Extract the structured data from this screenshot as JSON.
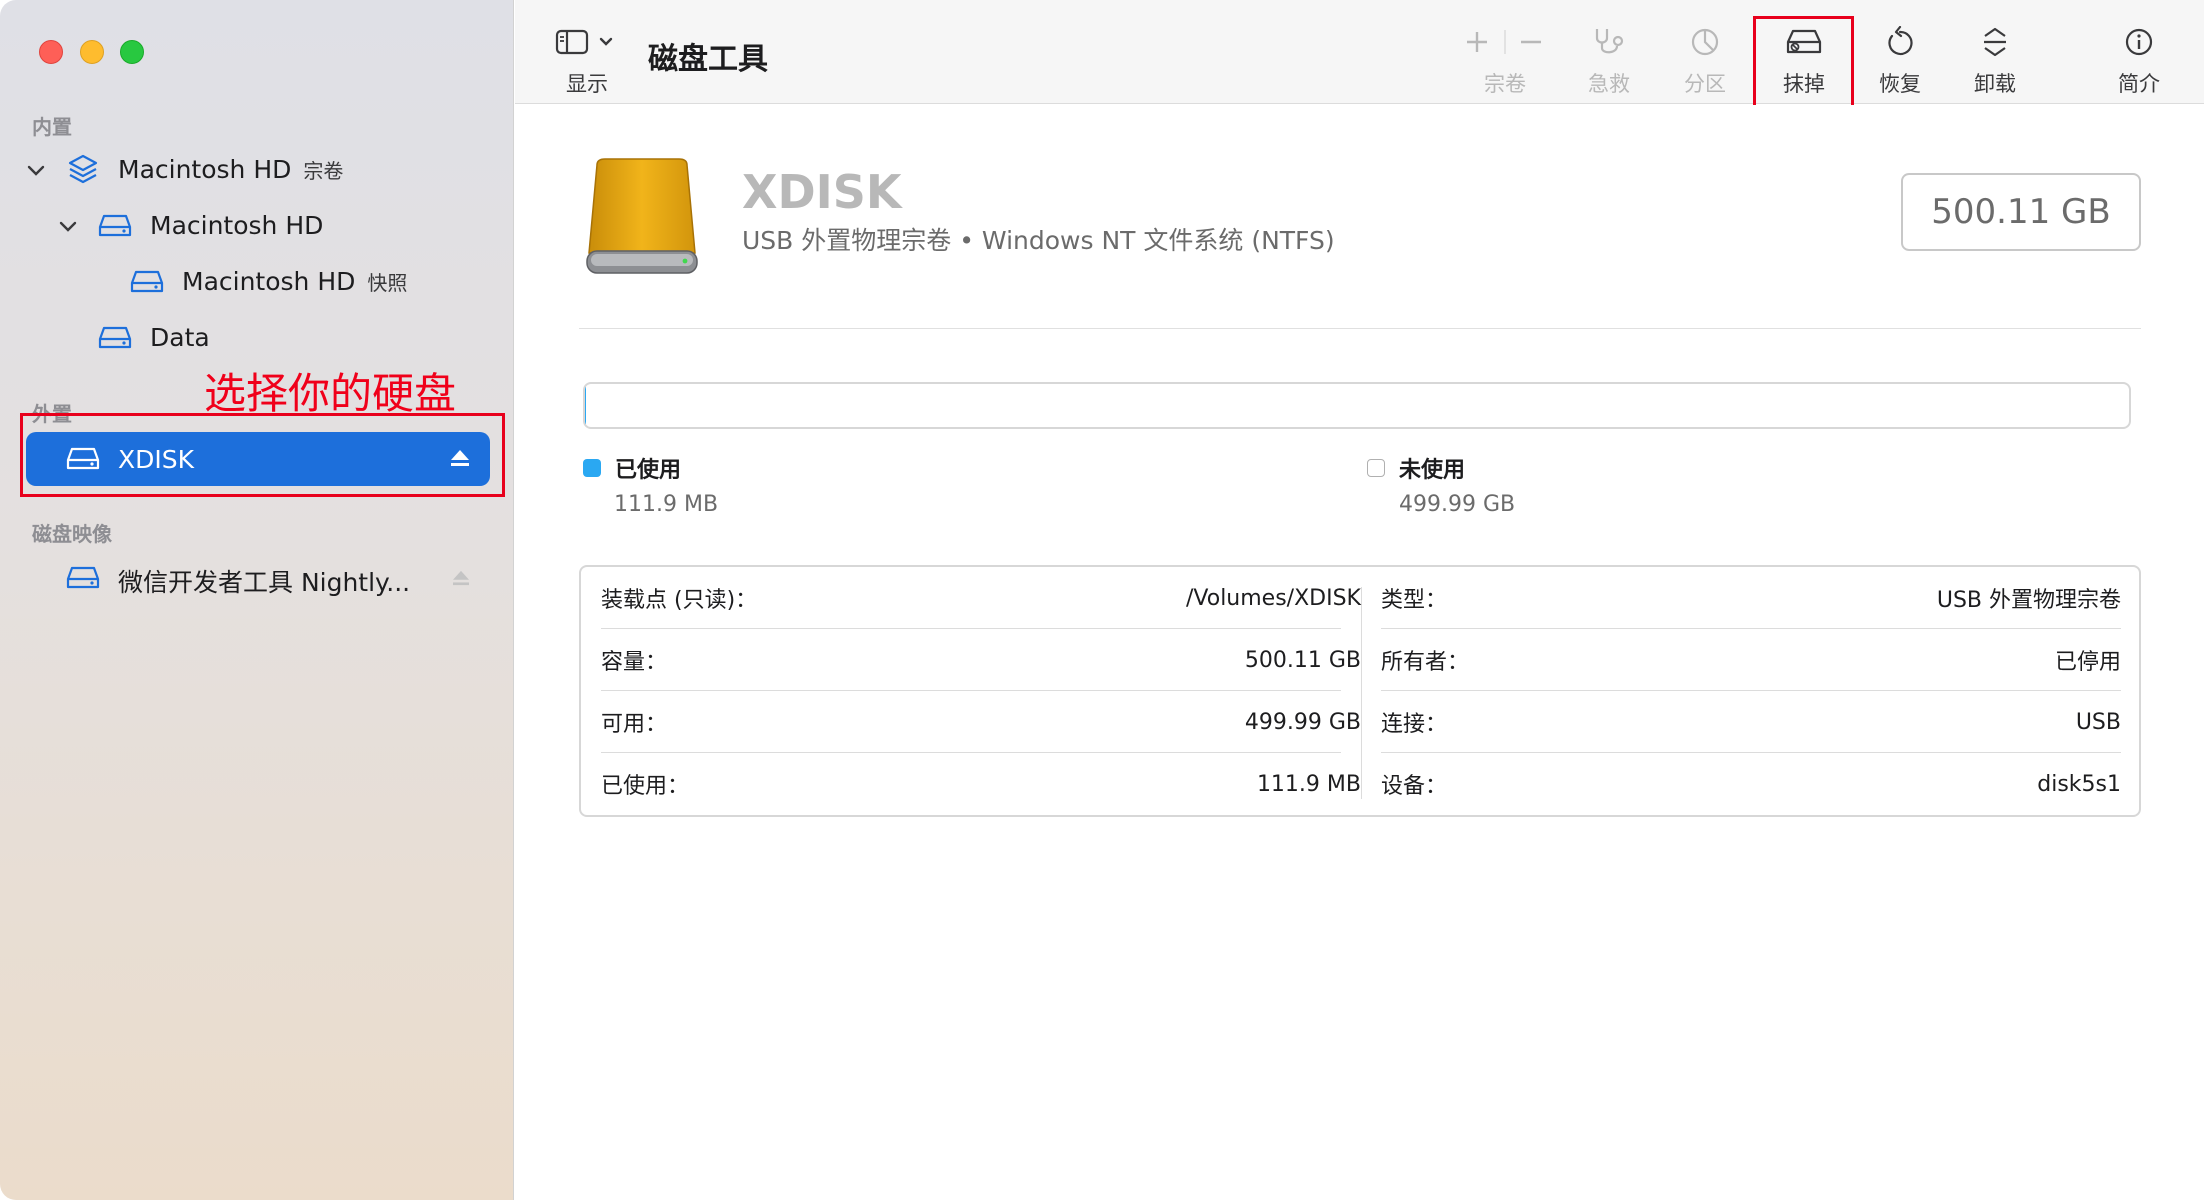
{
  "sidebar": {
    "sections": {
      "internal": "内置",
      "external": "外置",
      "disk_images": "磁盘映像"
    },
    "items": [
      {
        "label": "Macintosh HD",
        "sub": "宗卷"
      },
      {
        "label": "Macintosh HD",
        "sub": ""
      },
      {
        "label": "Macintosh HD",
        "sub": "快照"
      },
      {
        "label": "Data",
        "sub": ""
      },
      {
        "label": "XDISK",
        "sub": ""
      },
      {
        "label": "微信开发者工具 Nightly...",
        "sub": ""
      }
    ],
    "annotation": "选择你的硬盘"
  },
  "toolbar": {
    "view_label": "显示",
    "title": "磁盘工具",
    "buttons": {
      "volume": "宗卷",
      "first_aid": "急救",
      "partition": "分区",
      "erase": "抹掉",
      "restore": "恢复",
      "unmount": "卸载",
      "info": "简介"
    }
  },
  "disk": {
    "name": "XDISK",
    "description": "USB 外置物理宗卷 • Windows NT 文件系统 (NTFS)",
    "capacity": "500.11 GB",
    "used_fraction": 0.0002
  },
  "usage": {
    "used_label": "已使用",
    "used_value": "111.9 MB",
    "free_label": "未使用",
    "free_value": "499.99 GB"
  },
  "info": {
    "left": [
      {
        "k": "装载点 (只读)：",
        "v": "/Volumes/XDISK"
      },
      {
        "k": "容量：",
        "v": "500.11 GB"
      },
      {
        "k": "可用：",
        "v": "499.99 GB"
      },
      {
        "k": "已使用：",
        "v": "111.9 MB"
      }
    ],
    "right": [
      {
        "k": "类型：",
        "v": "USB 外置物理宗卷"
      },
      {
        "k": "所有者：",
        "v": "已停用"
      },
      {
        "k": "连接：",
        "v": "USB"
      },
      {
        "k": "设备：",
        "v": "disk5s1"
      }
    ]
  },
  "colors": {
    "accent": "#1d6fdb",
    "used": "#2aa8f2",
    "annotation": "#e8001c"
  }
}
